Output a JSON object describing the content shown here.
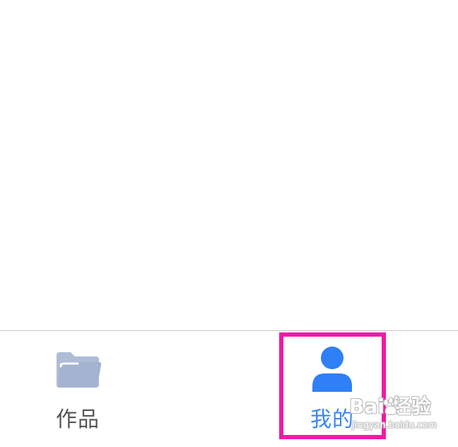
{
  "tab_bar": {
    "tabs": [
      {
        "label": "作品",
        "icon": "folder-icon",
        "active": false
      },
      {
        "label": "我的",
        "icon": "user-icon",
        "active": true
      }
    ]
  },
  "watermark": {
    "main": "Bai 经验",
    "sub": "jingyan.baidu.com"
  },
  "colors": {
    "active_tab": "#3b86f5",
    "inactive_icon": "#aebcd6",
    "inactive_label": "#555555",
    "highlight": "#f01aa8",
    "divider": "#c9c9c9"
  }
}
